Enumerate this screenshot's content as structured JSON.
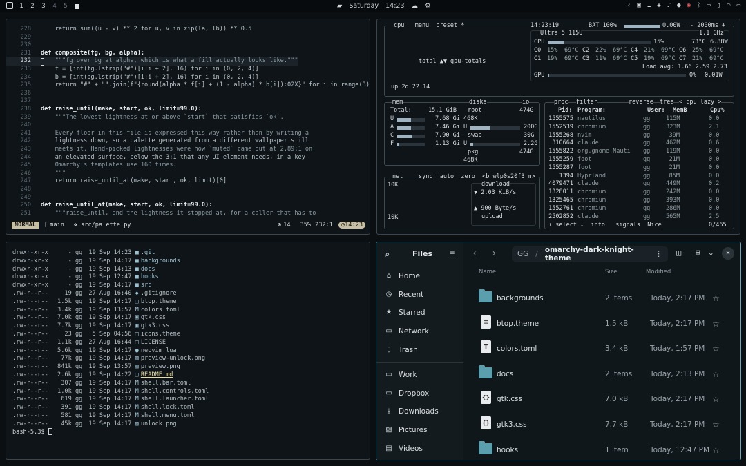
{
  "topbar": {
    "workspaces": [
      "1",
      "2",
      "3",
      "4",
      "5"
    ],
    "day": "Saturday",
    "time": "14:23",
    "tray_icons": [
      "chevron-left-icon",
      "lock-icon",
      "cloud-icon",
      "dropbox-icon",
      "bell-icon",
      "user-icon",
      "robot-icon",
      "bluetooth-icon",
      "display-icon",
      "mic-icon",
      "wifi-icon",
      "battery-icon"
    ]
  },
  "editor": {
    "lines": [
      {
        "n": "228",
        "t": "    return sum((u - v) ** 2 for u, v in zip(la, lb)) ** 0.5"
      },
      {
        "n": "229",
        "t": ""
      },
      {
        "n": "230",
        "t": ""
      },
      {
        "n": "231",
        "t": "def composite(fg, bg, alpha):"
      },
      {
        "n": "232",
        "t": "    \"\"\"fg over bg at alpha, which is what a fill actually looks like.\"\"\""
      },
      {
        "n": "233",
        "t": "    f = [int(fg.lstrip(\"#\")[i:i + 2], 16) for i in (0, 2, 4)]"
      },
      {
        "n": "234",
        "t": "    b = [int(bg.lstrip(\"#\")[i:i + 2], 16) for i in (0, 2, 4)]"
      },
      {
        "n": "235",
        "t": "    return \"#\" + \"\".join(f\"{round(alpha * f[i] + (1 - alpha) * b[i]):02X}\" for i in range(3)"
      },
      {
        "n": "236",
        "t": ""
      },
      {
        "n": "237",
        "t": ""
      },
      {
        "n": "238",
        "t": "def raise_until(make, start, ok, limit=99.0):"
      },
      {
        "n": "239",
        "t": "    \"\"\"The lowest lightness at or above `start` that satisfies `ok`."
      },
      {
        "n": "240",
        "t": ""
      },
      {
        "n": "241",
        "t": "    Every floor in this file is expressed this way rather than by writing a"
      },
      {
        "n": "242",
        "t": "    lightness down, so a palette generated from a different wallpaper still"
      },
      {
        "n": "243",
        "t": "    meets it. Hand-picked lightnesses were how `muted` came out at 2.89:1 on"
      },
      {
        "n": "244",
        "t": "    an elevated surface, below the 3:1 that any UI element needs, in a key"
      },
      {
        "n": "245",
        "t": "    Omarchy's templates use 160 times."
      },
      {
        "n": "246",
        "t": "    \"\"\""
      },
      {
        "n": "247",
        "t": "    return raise_until_at(make, start, ok, limit)[0]"
      },
      {
        "n": "248",
        "t": ""
      },
      {
        "n": "249",
        "t": ""
      },
      {
        "n": "250",
        "t": "def raise_until_at(make, start, ok, limit=99.0):"
      },
      {
        "n": "251",
        "t": "    \"\"\"raise_until, and the lightness it stopped at, for a caller that has to"
      }
    ],
    "status": {
      "mode": "NORMAL",
      "branch": "main",
      "file": "src/palette.py",
      "diag": "14",
      "percent": "35%",
      "pos": "232:1",
      "time": "14:23"
    }
  },
  "btop": {
    "cpu_header": "cpu   menu  preset *",
    "clock": "14:23:19",
    "bat": "BAT 100%",
    "power": "0.00W",
    "interval": "- 2000ms +",
    "model": "Ultra 5 115U",
    "freq": "1.1 GHz",
    "cpu_total": "CPU",
    "cpu_pct": "15%",
    "cpu_temp": "73°C",
    "cpu_w": "6.88W",
    "cores": [
      {
        "l": "C0",
        "p": "15%",
        "t": "69°C"
      },
      {
        "l": "C2",
        "p": "22%",
        "t": "69°C"
      },
      {
        "l": "C4",
        "p": "21%",
        "t": "69°C"
      },
      {
        "l": "C6",
        "p": "25%",
        "t": "69°C"
      },
      {
        "l": "C1",
        "p": "19%",
        "t": "69°C"
      },
      {
        "l": "C3",
        "p": "11%",
        "t": "69°C"
      },
      {
        "l": "C5",
        "p": "19%",
        "t": "69°C"
      },
      {
        "l": "C7",
        "p": "21%",
        "t": "69°C"
      }
    ],
    "load": "Load avg: 1.66 2.59 2.73",
    "gpu": "GPU",
    "gpu_pct": "0%",
    "gpu_w": "0.01W",
    "total": "total ▲▼ gpu-totals",
    "uptime": "up 2d 22:14",
    "mem": {
      "title": "mem",
      "total_l": "Total:",
      "total": "15.1 GiB",
      "rows": [
        {
          "k": "U",
          "v": "7.68 Gi"
        },
        {
          "k": "A",
          "v": "7.46 Gi"
        },
        {
          "k": "C",
          "v": "7.90 Gi"
        },
        {
          "k": "F",
          "v": "1.13 Gi"
        }
      ]
    },
    "disks": {
      "title": "disks",
      "io": "io",
      "root": "root",
      "root_sz": "474G",
      "root_used": "468K",
      "u": "U",
      "u_v": "200G",
      "swap": "swap",
      "swap_v": "30G",
      "u2": "U",
      "u2_v": "2.2G",
      "pkg": "pkg",
      "pkg_v": "474G",
      "pkg_used": "468K"
    },
    "net": {
      "title": "net",
      "opts": "sync  auto  zero  <b wlp0s20f3 n>",
      "scale": "10K",
      "scale2": "10K",
      "download": "download",
      "down_rate": "▼ 2.03 KiB/s",
      "up_rate": "▲ 900 Byte/s",
      "upload": "upload"
    },
    "proc": {
      "title": "proc",
      "filter": "filter",
      "reverse": "reverse",
      "tree": "tree",
      "cpu_lazy": "< cpu lazy >",
      "head": [
        "Pid:",
        "Program:",
        "User:",
        "MemB",
        "Cpu%"
      ],
      "rows": [
        [
          "1555575",
          "nautilus",
          "gg",
          "115M",
          "0.0"
        ],
        [
          "1552539",
          "chromium",
          "gg",
          "323M",
          "2.1"
        ],
        [
          "1555268",
          "nvim",
          "gg",
          "39M",
          "0.0"
        ],
        [
          "310664",
          "claude",
          "gg",
          "462M",
          "0.6"
        ],
        [
          "1555822",
          "org.gnome.Nauti",
          "gg",
          "119M",
          "0.0"
        ],
        [
          "1555259",
          "foot",
          "gg",
          "21M",
          "0.0"
        ],
        [
          "1555287",
          "foot",
          "gg",
          "21M",
          "0.0"
        ],
        [
          "1394",
          "Hyprland",
          "gg",
          "85M",
          "0.0"
        ],
        [
          "4079471",
          "claude",
          "gg",
          "449M",
          "0.2"
        ],
        [
          "1328011",
          "chromium",
          "gg",
          "242M",
          "0.0"
        ],
        [
          "1325465",
          "chromium",
          "gg",
          "393M",
          "0.0"
        ],
        [
          "1552761",
          "chromium",
          "gg",
          "286M",
          "0.0"
        ],
        [
          "2502852",
          "claude",
          "gg",
          "565M",
          "2.5"
        ]
      ],
      "footer": "↑ select ↓  info   signals  Nice",
      "count": "0/465"
    }
  },
  "terminal": {
    "lines": [
      [
        "drwxr-xr-x",
        "-",
        "gg",
        "19 Sep 14:23",
        "■",
        ".git",
        "dir"
      ],
      [
        "drwxr-xr-x",
        "-",
        "gg",
        "19 Sep 14:17",
        "■",
        "backgrounds",
        "dir"
      ],
      [
        "drwxr-xr-x",
        "-",
        "gg",
        "19 Sep 14:13",
        "■",
        "docs",
        "dir"
      ],
      [
        "drwxr-xr-x",
        "-",
        "gg",
        "19 Sep 12:47",
        "■",
        "hooks",
        "dir"
      ],
      [
        "drwxr-xr-x",
        "-",
        "gg",
        "19 Sep 14:17",
        "■",
        "src",
        "dir"
      ],
      [
        ".rw-r--r--",
        "19",
        "gg",
        "27 Aug 16:40",
        "◆",
        ".gitignore",
        ""
      ],
      [
        ".rw-r--r--",
        "1.5k",
        "gg",
        "19 Sep 14:17",
        "□",
        "btop.theme",
        ""
      ],
      [
        ".rw-r--r--",
        "3.4k",
        "gg",
        "19 Sep 13:57",
        "M",
        "colors.toml",
        ""
      ],
      [
        ".rw-r--r--",
        "7.0k",
        "gg",
        "19 Sep 14:17",
        "▣",
        "gtk.css",
        ""
      ],
      [
        ".rw-r--r--",
        "7.7k",
        "gg",
        "19 Sep 14:17",
        "▣",
        "gtk3.css",
        ""
      ],
      [
        ".rw-r--r--",
        "23",
        "gg",
        "5 Sep 04:56",
        "□",
        "icons.theme",
        ""
      ],
      [
        ".rw-r--r--",
        "1.1k",
        "gg",
        "27 Aug 16:44",
        "□",
        "LICENSE",
        ""
      ],
      [
        ".rw-r--r--",
        "5.6k",
        "gg",
        "19 Sep 14:17",
        "●",
        "neovim.lua",
        ""
      ],
      [
        ".rw-r--r--",
        "77k",
        "gg",
        "19 Sep 14:17",
        "▨",
        "preview-unlock.png",
        ""
      ],
      [
        ".rw-r--r--",
        "841k",
        "gg",
        "19 Sep 13:57",
        "▨",
        "preview.png",
        ""
      ],
      [
        ".rw-r--r--",
        "2.6k",
        "gg",
        "19 Sep 14:22",
        "□",
        "README.md",
        "hl"
      ],
      [
        ".rw-r--r--",
        "307",
        "gg",
        "19 Sep 14:17",
        "M",
        "shell.bar.toml",
        ""
      ],
      [
        ".rw-r--r--",
        "1.0k",
        "gg",
        "19 Sep 14:17",
        "M",
        "shell.controls.toml",
        ""
      ],
      [
        ".rw-r--r--",
        "619",
        "gg",
        "19 Sep 14:17",
        "M",
        "shell.launcher.toml",
        ""
      ],
      [
        ".rw-r--r--",
        "391",
        "gg",
        "19 Sep 14:17",
        "M",
        "shell.lock.toml",
        ""
      ],
      [
        ".rw-r--r--",
        "581",
        "gg",
        "19 Sep 14:17",
        "M",
        "shell.menu.toml",
        ""
      ],
      [
        ".rw-r--r--",
        "45k",
        "gg",
        "19 Sep 14:17",
        "▨",
        "unlock.png",
        ""
      ]
    ],
    "prompt": "bash-5.3$"
  },
  "files": {
    "app_title": "Files",
    "path_root": "GG",
    "path_sep": "/",
    "path_current": "omarchy-dark-knight-theme",
    "sidebar": [
      {
        "label": "Home",
        "icon": "home-icon"
      },
      {
        "label": "Recent",
        "icon": "clock-icon"
      },
      {
        "label": "Starred",
        "icon": "star-icon"
      },
      {
        "label": "Network",
        "icon": "network-icon"
      },
      {
        "label": "Trash",
        "icon": "trash-icon"
      }
    ],
    "sidebar2": [
      {
        "label": "Work",
        "icon": "folder-icon"
      },
      {
        "label": "Dropbox",
        "icon": "folder-icon"
      },
      {
        "label": "Downloads",
        "icon": "download-icon"
      },
      {
        "label": "Pictures",
        "icon": "picture-icon"
      },
      {
        "label": "Videos",
        "icon": "video-icon"
      }
    ],
    "columns": {
      "name": "Name",
      "size": "Size",
      "modified": "Modified"
    },
    "rows": [
      {
        "name": "backgrounds",
        "size": "2 items",
        "modified": "Today, 2:17 PM",
        "kind": "folder"
      },
      {
        "name": "btop.theme",
        "size": "1.5 kB",
        "modified": "Today, 2:17 PM",
        "kind": "doc",
        "glyph": "≡"
      },
      {
        "name": "colors.toml",
        "size": "3.4 kB",
        "modified": "Today, 1:57 PM",
        "kind": "doc",
        "glyph": "T"
      },
      {
        "name": "docs",
        "size": "2 items",
        "modified": "Today, 2:13 PM",
        "kind": "folder"
      },
      {
        "name": "gtk.css",
        "size": "7.0 kB",
        "modified": "Today, 2:17 PM",
        "kind": "doc",
        "glyph": "{}"
      },
      {
        "name": "gtk3.css",
        "size": "7.7 kB",
        "modified": "Today, 2:17 PM",
        "kind": "doc",
        "glyph": "{}"
      },
      {
        "name": "hooks",
        "size": "1 item",
        "modified": "Today, 12:47 PM",
        "kind": "folder"
      }
    ]
  }
}
